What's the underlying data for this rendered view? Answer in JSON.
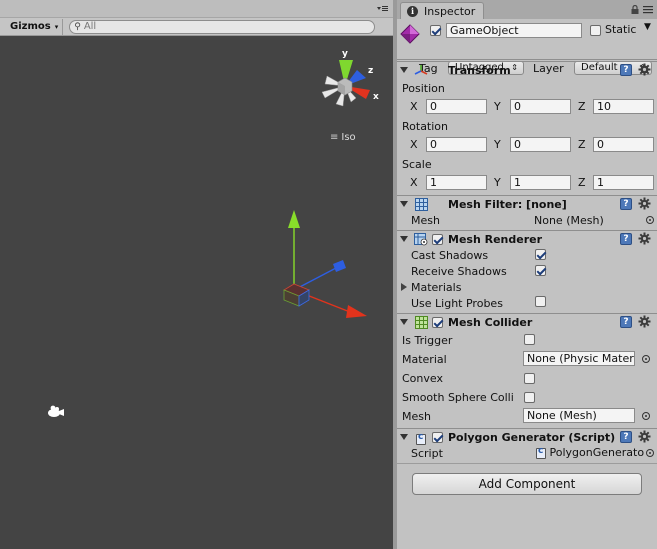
{
  "scene": {
    "gizmos_label": "Gizmos",
    "gizmos_arrow": "▾",
    "search_placeholder": "All",
    "orientation_label": "Iso",
    "axis_labels": {
      "x": "x",
      "y": "y",
      "z": "z"
    }
  },
  "inspector": {
    "tab_label": "Inspector",
    "game_object": {
      "active": true,
      "name": "GameObject",
      "static_label": "Static",
      "static": false,
      "tag_label": "Tag",
      "tag_value": "Untagged",
      "layer_label": "Layer",
      "layer_value": "Default"
    },
    "transform": {
      "title": "Transform",
      "position_label": "Position",
      "rotation_label": "Rotation",
      "scale_label": "Scale",
      "axis": [
        "X",
        "Y",
        "Z"
      ],
      "position": [
        "0",
        "0",
        "10"
      ],
      "rotation": [
        "0",
        "0",
        "0"
      ],
      "scale": [
        "1",
        "1",
        "1"
      ]
    },
    "mesh_filter": {
      "title": "Mesh Filter: [none]",
      "mesh_label": "Mesh",
      "mesh_value": "None (Mesh)"
    },
    "mesh_renderer": {
      "title": "Mesh Renderer",
      "enabled": true,
      "cast_shadows_label": "Cast Shadows",
      "cast_shadows": true,
      "receive_shadows_label": "Receive Shadows",
      "receive_shadows": true,
      "materials_label": "Materials",
      "use_light_probes_label": "Use Light Probes",
      "use_light_probes": false
    },
    "mesh_collider": {
      "title": "Mesh Collider",
      "enabled": true,
      "is_trigger_label": "Is Trigger",
      "is_trigger": false,
      "material_label": "Material",
      "material_value": "None (Physic Mater",
      "convex_label": "Convex",
      "convex": false,
      "smooth_label": "Smooth Sphere Colli",
      "smooth": false,
      "mesh_label": "Mesh",
      "mesh_value": "None (Mesh)"
    },
    "polygon_generator": {
      "title": "Polygon Generator (Script)",
      "enabled": true,
      "script_label": "Script",
      "script_value": "PolygonGenerato"
    },
    "add_component_label": "Add Component"
  }
}
